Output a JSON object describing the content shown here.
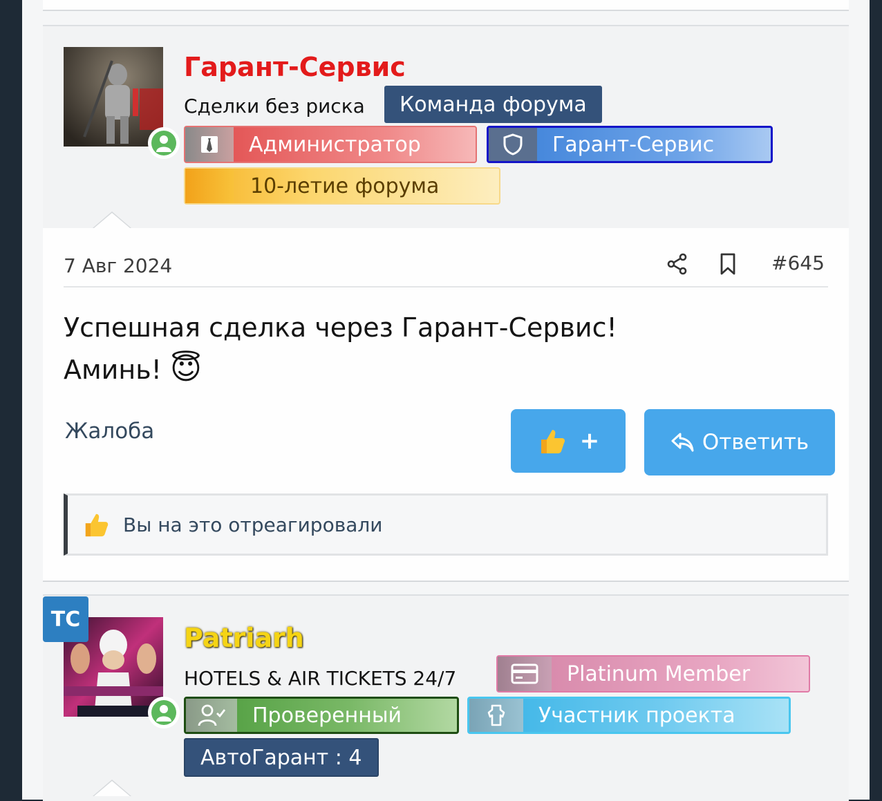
{
  "posts": [
    {
      "username": "Гарант-Сервис",
      "username_color": "#e31b1b",
      "user_title": "Сделки без риска",
      "badges": {
        "team": "Команда форума",
        "admin": "Администратор",
        "guarant": "Гарант-Сервис",
        "anniversary": "10-летие форума"
      },
      "date": "7 Авг 2024",
      "post_number": "#645",
      "message_lines": [
        "Успешная сделка через Гарант-Сервис!",
        "Аминь!"
      ],
      "message_emoji": "😇",
      "report_label": "Жалоба",
      "like_label": "+",
      "reply_label": "Ответить",
      "reaction_text": "Вы на это отреагировали"
    },
    {
      "tc_badge": "TC",
      "username": "Patriarh",
      "username_color": "#f5d415",
      "user_title": "HOTELS & AIR TICKETS 24/7",
      "badges": {
        "platinum": "Platinum Member",
        "verified": "Проверенный",
        "participant": "Участник проекта",
        "autoguarant": "АвтоГарант : 4"
      }
    }
  ],
  "icons": {
    "share": "share-icon",
    "bookmark": "bookmark-icon",
    "thumbs_up": "thumbs-up-icon",
    "reply": "reply-icon",
    "online": "online-user-icon"
  },
  "colors": {
    "accent_button": "#47a7eb",
    "team_badge": "#34527a",
    "online_status": "#5cb85c"
  }
}
